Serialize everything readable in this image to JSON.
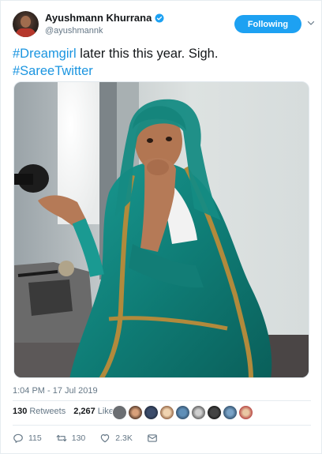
{
  "author": {
    "display_name": "Ayushmann Khurrana",
    "handle": "@ayushmannk",
    "verified": true
  },
  "follow_button": {
    "label": "Following"
  },
  "tweet": {
    "hashtag_1": "#Dreamgirl",
    "text_1": " later this this year. Sigh.",
    "hashtag_2": "#SareeTwitter"
  },
  "timestamp": "1:04 PM - 17 Jul 2019",
  "stats": {
    "retweets_count": "130",
    "retweets_label": "Retweets",
    "likes_count": "2,267",
    "likes_label": "Likes"
  },
  "actions": {
    "reply_count": "115",
    "retweet_count": "130",
    "like_count": "2.3K"
  },
  "icons": {
    "verified": "verified-badge-icon",
    "caret": "chevron-down-icon",
    "reply": "reply-icon",
    "retweet": "retweet-icon",
    "like": "heart-icon",
    "dm": "envelope-icon"
  },
  "colors": {
    "accent": "#1da1f2",
    "hashtag": "#1b95e0",
    "muted": "#657786",
    "saree": "#12807a"
  }
}
